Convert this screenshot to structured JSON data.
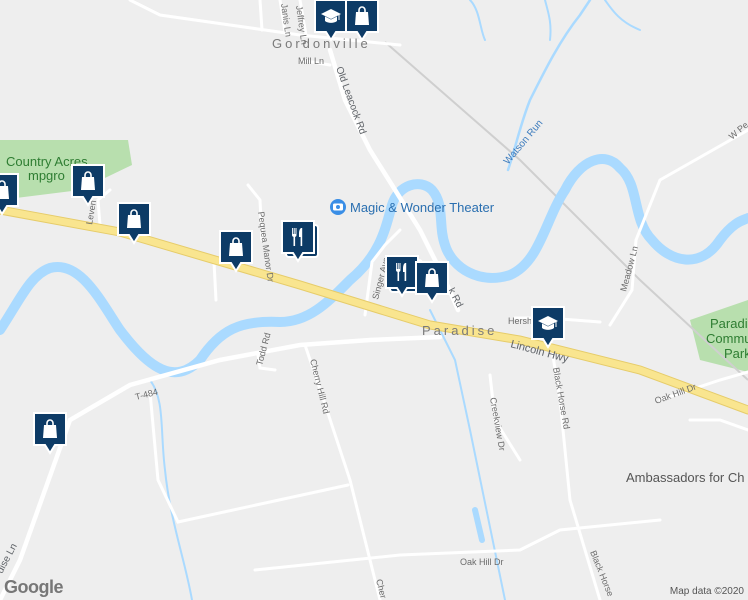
{
  "map": {
    "town_labels": [
      "Gordonville",
      "Paradise"
    ],
    "road_labels": {
      "old_leacock": "Old Leacock Rd",
      "lincoln_hwy": "Lincoln Hwy",
      "t484": "T-484",
      "cherry_hill": "Cherry Hill Rd",
      "black_horse": "Black Horse Rd",
      "black_horse_lower": "Black Horse",
      "oak_hill_lower": "Oak Hill Dr",
      "oak_hill_right": "Oak Hill Dr",
      "meadow": "Meadow Ln",
      "creekview": "Creekview Dr",
      "todd": "Todd Rd",
      "singer": "Singer Ave",
      "pequea_manor": "Pequea Manor Dr",
      "mill": "Mill Ln",
      "hershey": "Hershey",
      "leacock_k": "k Rd",
      "paradise_ln": "dise Ln",
      "leven": "Leven",
      "janis": "Janis Ln",
      "jeffrey": "Jeffrey Ln",
      "w_pe": "W Pe",
      "cherry_lower": "Cher"
    },
    "water_label": "Watson Run",
    "poi_labels": {
      "theater": "Magic & Wonder Theater",
      "country_acres": "Country Acres",
      "campground": "mpgro",
      "paradise_community": "Paradise",
      "community": "Commu",
      "park": "Park",
      "ambassadors": "Ambassadors for Ch"
    },
    "attribution": "Map data ©2020",
    "logo": "Google",
    "colors": {
      "background": "#eeeeee",
      "highway": "#f9e58f",
      "road": "#ffffff",
      "river": "#aadaff",
      "park": "#b8dfae",
      "marker": "#0d3b66"
    }
  },
  "markers": [
    {
      "type": "school",
      "icon": "graduation-cap-icon"
    },
    {
      "type": "shopping",
      "icon": "shopping-bag-icon"
    },
    {
      "type": "shopping",
      "icon": "shopping-bag-icon"
    },
    {
      "type": "shopping",
      "icon": "shopping-bag-icon"
    },
    {
      "type": "shopping",
      "icon": "shopping-bag-icon"
    },
    {
      "type": "shopping",
      "icon": "shopping-bag-icon"
    },
    {
      "type": "restaurant",
      "icon": "fork-knife-icon"
    },
    {
      "type": "restaurant",
      "icon": "fork-knife-icon"
    },
    {
      "type": "shopping",
      "icon": "shopping-bag-icon"
    },
    {
      "type": "school",
      "icon": "graduation-cap-icon"
    },
    {
      "type": "shopping",
      "icon": "shopping-bag-icon"
    }
  ]
}
